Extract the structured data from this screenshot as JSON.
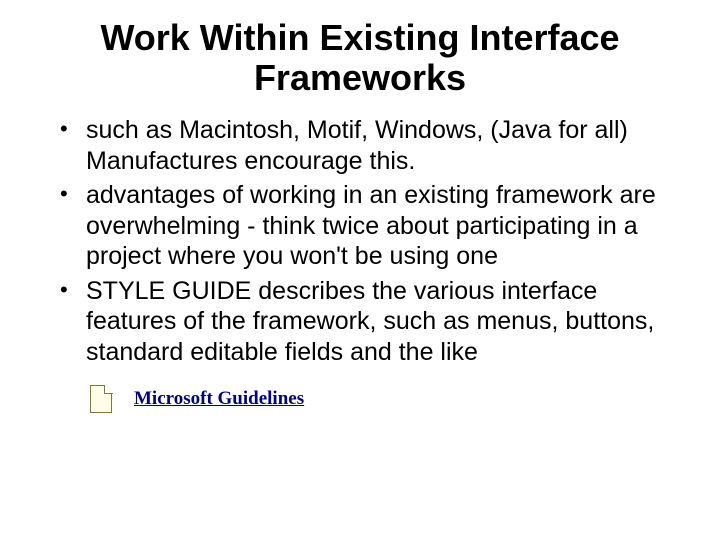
{
  "title": "Work Within Existing Interface Frameworks",
  "bullets": [
    "such as Macintosh, Motif, Windows, (Java for all)  Manufactures encourage this.",
    "advantages of working in an existing framework are overwhelming - think twice about participating in a project where you won't be using one",
    "STYLE GUIDE describes the various interface features of the framework, such as menus, buttons, standard editable fields and the like"
  ],
  "link": {
    "label": "Microsoft Guidelines"
  }
}
